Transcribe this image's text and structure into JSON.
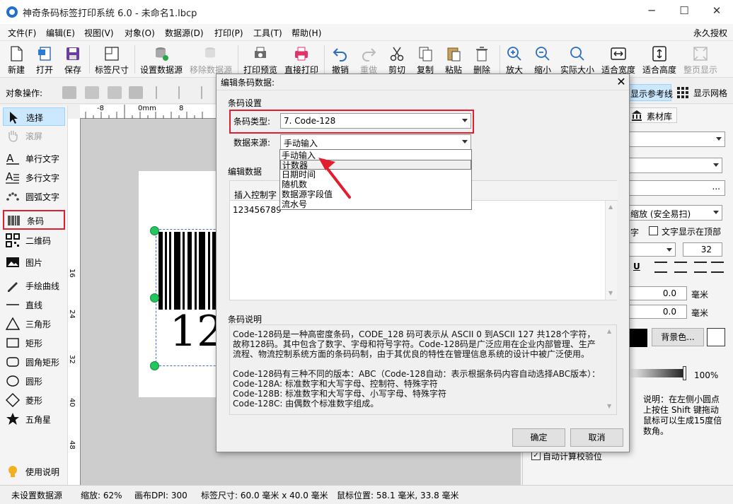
{
  "window": {
    "title": "神奇条码标签打印系统 6.0 - 未命名1.lbcp",
    "minimize": "─",
    "maximize": "☐",
    "close": "✕"
  },
  "menu": [
    "文件(F)",
    "编辑(E)",
    "视图(V)",
    "对象(O)",
    "数据源(D)",
    "打印(P)",
    "工具(T)",
    "帮助(H)"
  ],
  "menu_right": "永久授权",
  "toolbar": [
    {
      "label": "新建",
      "icon": "new-file-icon",
      "enabled": true
    },
    {
      "label": "打开",
      "icon": "open-icon",
      "enabled": true
    },
    {
      "label": "保存",
      "icon": "save-icon",
      "enabled": true
    },
    {
      "label": "标签尺寸",
      "icon": "label-size-icon",
      "enabled": true
    },
    {
      "label": "设置数据源",
      "icon": "database-icon",
      "enabled": true
    },
    {
      "label": "移除数据源",
      "icon": "remove-database-icon",
      "enabled": false
    },
    {
      "label": "打印预览",
      "icon": "print-preview-icon",
      "enabled": true
    },
    {
      "label": "直接打印",
      "icon": "printer-icon",
      "enabled": true
    },
    {
      "label": "撤销",
      "icon": "undo-icon",
      "enabled": true
    },
    {
      "label": "重做",
      "icon": "redo-icon",
      "enabled": false
    },
    {
      "label": "剪切",
      "icon": "cut-icon",
      "enabled": true
    },
    {
      "label": "复制",
      "icon": "copy-icon",
      "enabled": true
    },
    {
      "label": "粘贴",
      "icon": "paste-icon",
      "enabled": true
    },
    {
      "label": "删除",
      "icon": "delete-icon",
      "enabled": true
    },
    {
      "label": "放大",
      "icon": "zoom-in-icon",
      "enabled": true
    },
    {
      "label": "缩小",
      "icon": "zoom-out-icon",
      "enabled": true
    },
    {
      "label": "实际大小",
      "icon": "actual-size-icon",
      "enabled": true
    },
    {
      "label": "适合宽度",
      "icon": "fit-width-icon",
      "enabled": true
    },
    {
      "label": "适合高度",
      "icon": "fit-height-icon",
      "enabled": true
    },
    {
      "label": "整页显示",
      "icon": "full-page-icon",
      "enabled": false
    }
  ],
  "objbar": {
    "label": "对象操作:",
    "ref_line": "显示参考线",
    "grid": "显示网格"
  },
  "tools": [
    {
      "label": "选择",
      "icon": "cursor-icon"
    },
    {
      "label": "滚屏",
      "icon": "hand-icon"
    },
    {
      "label": "单行文字",
      "icon": "single-text-icon"
    },
    {
      "label": "多行文字",
      "icon": "multi-text-icon"
    },
    {
      "label": "圆弧文字",
      "icon": "arc-text-icon"
    },
    {
      "label": "条码",
      "icon": "barcode-icon"
    },
    {
      "label": "二维码",
      "icon": "qrcode-icon"
    },
    {
      "label": "图片",
      "icon": "image-icon"
    },
    {
      "label": "手绘曲线",
      "icon": "pen-icon"
    },
    {
      "label": "直线",
      "icon": "line-icon"
    },
    {
      "label": "三角形",
      "icon": "triangle-icon"
    },
    {
      "label": "矩形",
      "icon": "rectangle-icon"
    },
    {
      "label": "圆角矩形",
      "icon": "rounded-rect-icon"
    },
    {
      "label": "圆形",
      "icon": "circle-icon"
    },
    {
      "label": "菱形",
      "icon": "diamond-icon"
    },
    {
      "label": "五角星",
      "icon": "star-icon"
    }
  ],
  "help": "使用说明",
  "ruler_top": [
    "-8",
    "0mm",
    "8"
  ],
  "ruler_left": [
    "16",
    "24",
    "32",
    "40",
    "48"
  ],
  "barcode_text": "12",
  "right": {
    "tab": "素材库",
    "scale": "缩放 (安全易扫)",
    "text_top_frag": "字",
    "text_top": "文字显示在顶部",
    "font_size": "32",
    "x_val": "0.0",
    "y_val": "0.0",
    "unit": "毫米",
    "bg_btn": "背景色...",
    "opacity": "100%",
    "help": "说明：在左侧小圆点上按住 Shift 键拖动鼠标可以生成15度倍数角。",
    "checksum": "自动计算校验位"
  },
  "status": {
    "source": "未设置数据源",
    "zoom": "缩放: 62%",
    "dpi": "画布DPI: 300",
    "size": "标签尺寸: 60.0 毫米 x 40.0 毫米",
    "mouse": "鼠标位置: 58.1 毫米, 33.8 毫米"
  },
  "dialog": {
    "title": "编辑条码数据:",
    "settings": "条码设置",
    "type_label": "条码类型:",
    "type_value": "7. Code-128",
    "source_label": "数据来源:",
    "source_value": "手动输入",
    "options": [
      "手动输入",
      "计数器",
      "日期时间",
      "随机数",
      "数据源字段值",
      "流水号"
    ],
    "edit_section": "编辑数据",
    "insert_ctrl": "插入控制字",
    "data_value": "123456789",
    "desc_section": "条码说明",
    "desc": "Code-128码是一种高密度条码，CODE_128 码可表示从 ASCII 0 到ASCII 127 共128个字符，故称128码。其中包含了数字、字母和符号字符。Code-128码是广泛应用在企业内部管理、生产流程、物流控制系统方面的条码码制，由于其优良的特性在管理信息系统的设计中被广泛使用。\n\nCode-128码有三种不同的版本：ABC（Code-128自动：表示根据条码内容自动选择ABC版本）：\nCode-128A: 标准数字和大写字母、控制符、特殊字符\nCode-128B: 标准数字和大写字母、小写字母、特殊字符\nCode-128C: 由偶数个标准数字组成。",
    "ok": "确定",
    "cancel": "取消"
  },
  "colors": {
    "highlight_red": "#e11d2e",
    "selection_blue": "#cce8ff",
    "handle_green": "#22c55e"
  }
}
